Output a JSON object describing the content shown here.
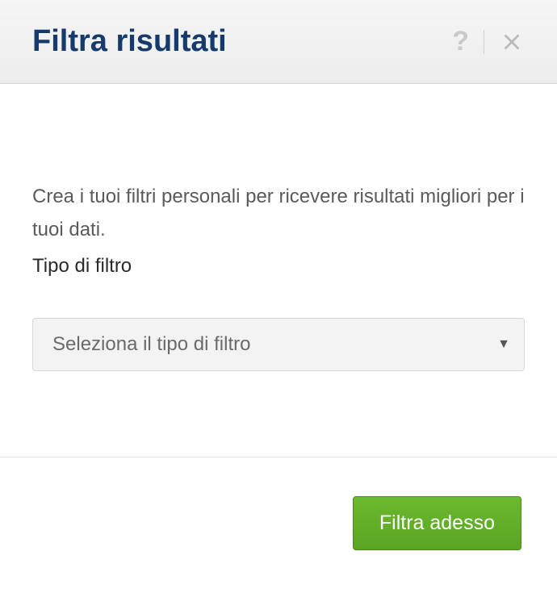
{
  "header": {
    "title": "Filtra risultati"
  },
  "body": {
    "description": "Crea i tuoi filtri personali per ricevere risultati migliori per i tuoi dati.",
    "filter_label": "Tipo di filtro",
    "select_placeholder": "Seleziona il tipo di filtro"
  },
  "footer": {
    "submit_label": "Filtra adesso"
  }
}
